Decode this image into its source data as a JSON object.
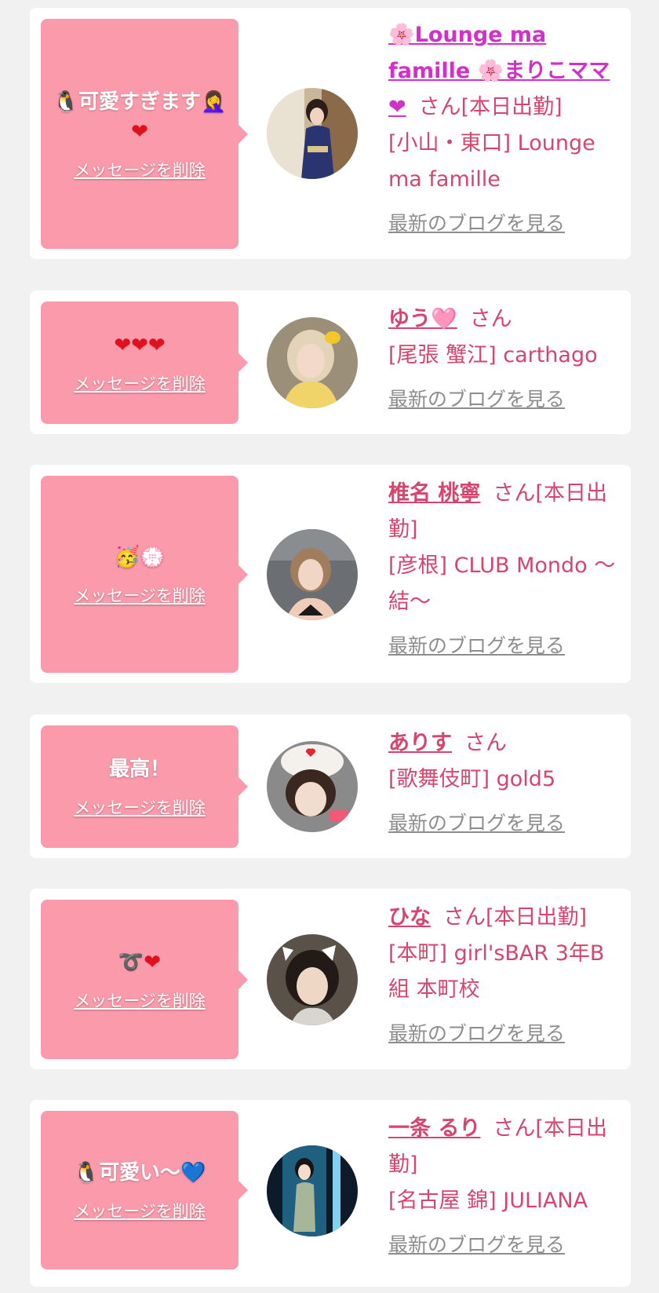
{
  "delete_label": "メッセージを削除",
  "blog_label": "最新のブログを見る",
  "san_label": "さん",
  "cards": [
    {
      "message": "🐧可愛すぎます🤦‍♀️",
      "message_extra": "❤",
      "name": "🌸Lounge ma famille 🌸まりこママ❤",
      "suffix": "さん[本日出勤]",
      "shop": "[小山・東口] Lounge ma famille"
    },
    {
      "message": "❤❤❤",
      "name": "ゆう🩷",
      "suffix": "さん",
      "shop": "[尾張 蟹江] carthago"
    },
    {
      "message": "🥳💮",
      "name": "椎名 桃寧",
      "suffix": "さん[本日出勤]",
      "shop": "[彦根] CLUB Mondo 〜結〜"
    },
    {
      "message": "最高！",
      "name": "ありす",
      "suffix": "さん",
      "shop": "[歌舞伎町] gold5"
    },
    {
      "message": "➰❤",
      "name": "ひな",
      "suffix": "さん[本日出勤]",
      "shop": "[本町] girl'sBAR 3年B組 本町校"
    },
    {
      "message": "🐧可愛い〜💙",
      "name": "一条 るり",
      "suffix": "さん[本日出勤]",
      "shop": "[名古屋 錦] JULIANA"
    }
  ],
  "colors": {
    "background": "#f1f1f1",
    "bubble": "#fa9aab",
    "accent": "#d6456e",
    "link_gray": "#8d8d8d"
  }
}
